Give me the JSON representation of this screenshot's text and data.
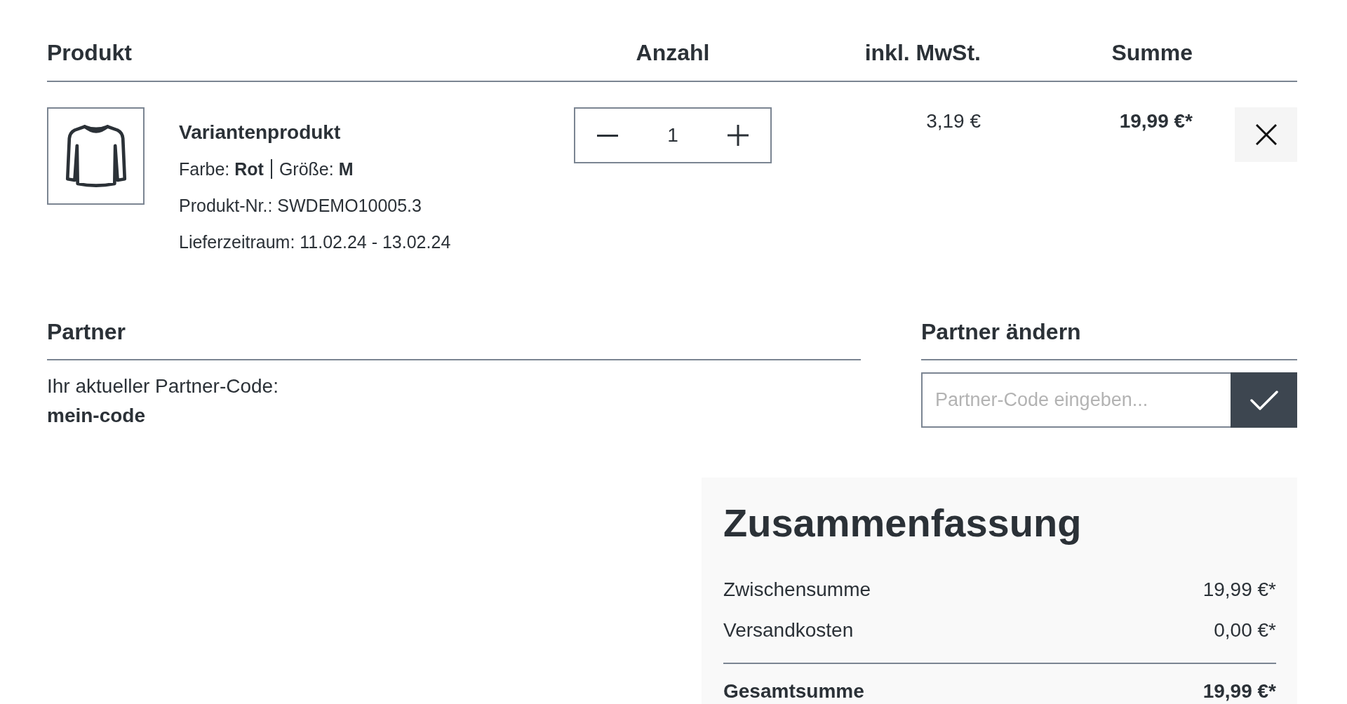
{
  "cart_table": {
    "columns": [
      "Produkt",
      "Anzahl",
      "inkl. MwSt.",
      "Summe"
    ],
    "rows": [
      {
        "name": "Variantenprodukt",
        "options": [
          {
            "label": "Farbe:",
            "value": "Rot"
          },
          {
            "label": "Größe:",
            "value": "M"
          }
        ],
        "product_number": "Produkt-Nr.: SWDEMO10005.3",
        "delivery": "Lieferzeitraum: 11.02.24 - 13.02.24",
        "quantity": {
          "value": "1"
        },
        "tax": "3,19 €",
        "total": "19,99 €*"
      }
    ]
  },
  "partner": {
    "title": "Partner",
    "label": "Ihr aktueller Partner-Code:",
    "code": "mein-code"
  },
  "partner_change": {
    "title": "Partner ändern",
    "input": {
      "placeholder": "Partner-Code eingeben..."
    }
  },
  "summary": {
    "title": "Zusammenfassung",
    "rows": [
      {
        "label": "Zwischensumme",
        "value": "19,99 €*"
      },
      {
        "label": "Versandkosten",
        "value": "0,00 €*"
      }
    ],
    "total": {
      "label": "Gesamtsumme",
      "value": "19,99 €*"
    }
  }
}
